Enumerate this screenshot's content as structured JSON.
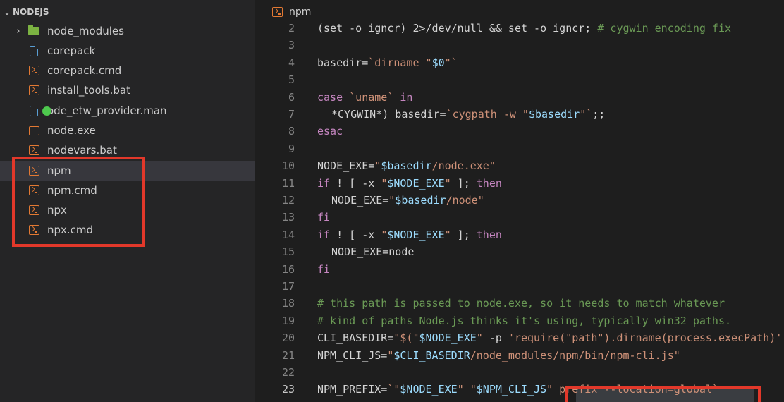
{
  "explorer": {
    "section_title": "NODEJS",
    "items": [
      {
        "label": "node_modules",
        "icon": "folder-icon",
        "twisty": "›"
      },
      {
        "label": "corepack",
        "icon": "file-icon"
      },
      {
        "label": "corepack.cmd",
        "icon": "terminal-icon"
      },
      {
        "label": "install_tools.bat",
        "icon": "terminal-icon"
      },
      {
        "label": "ode_etw_provider.man",
        "icon": "file-icon"
      },
      {
        "label": "node.exe",
        "icon": "exe-icon"
      },
      {
        "label": "nodevars.bat",
        "icon": "terminal-icon"
      },
      {
        "label": "npm",
        "icon": "terminal-icon",
        "selected": true
      },
      {
        "label": "npm.cmd",
        "icon": "terminal-icon"
      },
      {
        "label": "npx",
        "icon": "terminal-icon"
      },
      {
        "label": "npx.cmd",
        "icon": "terminal-icon"
      }
    ]
  },
  "editor": {
    "tab_title": "npm",
    "active_line": "23",
    "lines": [
      {
        "n": "2",
        "tokens": [
          [
            "t-def",
            "(set -o igncr) 2>/dev/null && set -o igncr; "
          ],
          [
            "t-cm",
            "# cygwin encoding fix"
          ]
        ]
      },
      {
        "n": "3",
        "tokens": []
      },
      {
        "n": "4",
        "tokens": [
          [
            "t-def",
            "basedir="
          ],
          [
            "t-str",
            "`dirname \""
          ],
          [
            "t-var",
            "$0"
          ],
          [
            "t-str",
            "\"`"
          ]
        ]
      },
      {
        "n": "5",
        "tokens": []
      },
      {
        "n": "6",
        "tokens": [
          [
            "t-kw",
            "case"
          ],
          [
            "t-def",
            " "
          ],
          [
            "t-str",
            "`uname`"
          ],
          [
            "t-def",
            " "
          ],
          [
            "t-kw",
            "in"
          ]
        ]
      },
      {
        "n": "7",
        "indent": true,
        "tokens": [
          [
            "t-def",
            "*CYGWIN*) basedir="
          ],
          [
            "t-str",
            "`cygpath -w \""
          ],
          [
            "t-var",
            "$basedir"
          ],
          [
            "t-str",
            "\"`"
          ],
          [
            "t-def",
            ";;"
          ]
        ]
      },
      {
        "n": "8",
        "tokens": [
          [
            "t-kw",
            "esac"
          ]
        ]
      },
      {
        "n": "9",
        "tokens": []
      },
      {
        "n": "10",
        "tokens": [
          [
            "t-def",
            "NODE_EXE="
          ],
          [
            "t-str",
            "\""
          ],
          [
            "t-var",
            "$basedir"
          ],
          [
            "t-str",
            "/node.exe\""
          ]
        ]
      },
      {
        "n": "11",
        "tokens": [
          [
            "t-kw",
            "if"
          ],
          [
            "t-def",
            " ! [ -x "
          ],
          [
            "t-str",
            "\""
          ],
          [
            "t-var",
            "$NODE_EXE"
          ],
          [
            "t-str",
            "\""
          ],
          [
            "t-def",
            " ]; "
          ],
          [
            "t-kw",
            "then"
          ]
        ]
      },
      {
        "n": "12",
        "indent": true,
        "tokens": [
          [
            "t-def",
            "NODE_EXE="
          ],
          [
            "t-str",
            "\""
          ],
          [
            "t-var",
            "$basedir"
          ],
          [
            "t-str",
            "/node\""
          ]
        ]
      },
      {
        "n": "13",
        "tokens": [
          [
            "t-kw",
            "fi"
          ]
        ]
      },
      {
        "n": "14",
        "tokens": [
          [
            "t-kw",
            "if"
          ],
          [
            "t-def",
            " ! [ -x "
          ],
          [
            "t-str",
            "\""
          ],
          [
            "t-var",
            "$NODE_EXE"
          ],
          [
            "t-str",
            "\""
          ],
          [
            "t-def",
            " ]; "
          ],
          [
            "t-kw",
            "then"
          ]
        ]
      },
      {
        "n": "15",
        "indent": true,
        "tokens": [
          [
            "t-def",
            "NODE_EXE=node"
          ]
        ]
      },
      {
        "n": "16",
        "tokens": [
          [
            "t-kw",
            "fi"
          ]
        ]
      },
      {
        "n": "17",
        "tokens": []
      },
      {
        "n": "18",
        "tokens": [
          [
            "t-cm",
            "# this path is passed to node.exe, so it needs to match whatever"
          ]
        ]
      },
      {
        "n": "19",
        "tokens": [
          [
            "t-cm",
            "# kind of paths Node.js thinks it's using, typically win32 paths."
          ]
        ]
      },
      {
        "n": "20",
        "tokens": [
          [
            "t-def",
            "CLI_BASEDIR="
          ],
          [
            "t-str",
            "\"$(\""
          ],
          [
            "t-var",
            "$NODE_EXE"
          ],
          [
            "t-str",
            "\""
          ],
          [
            "t-def",
            " -p "
          ],
          [
            "t-str",
            "'require(\"path\").dirname(process.execPath)'"
          ]
        ]
      },
      {
        "n": "21",
        "tokens": [
          [
            "t-def",
            "NPM_CLI_JS="
          ],
          [
            "t-str",
            "\""
          ],
          [
            "t-var",
            "$CLI_BASEDIR"
          ],
          [
            "t-str",
            "/node_modules/npm/bin/npm-cli.js\""
          ]
        ]
      },
      {
        "n": "22",
        "tokens": []
      },
      {
        "n": "23",
        "tokens": [
          [
            "t-def",
            "NPM_PREFIX="
          ],
          [
            "t-str",
            "`\""
          ],
          [
            "t-var",
            "$NODE_EXE"
          ],
          [
            "t-str",
            "\" \""
          ],
          [
            "t-var",
            "$NPM_CLI_JS"
          ],
          [
            "t-str",
            "\" prefix --location=global`"
          ]
        ]
      }
    ]
  }
}
